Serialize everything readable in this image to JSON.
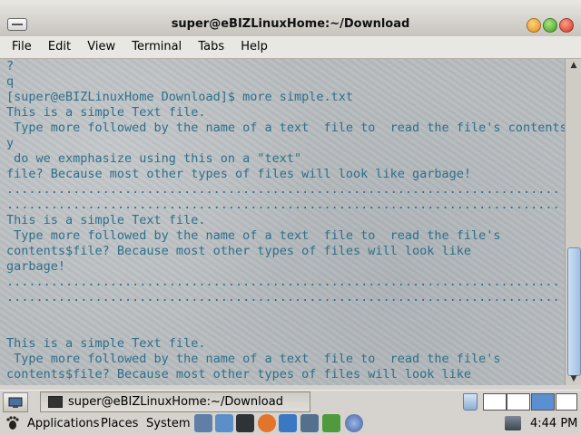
{
  "window": {
    "title": "super@eBIZLinuxHome:~/Download"
  },
  "menubar": {
    "items": [
      "File",
      "Edit",
      "View",
      "Terminal",
      "Tabs",
      "Help"
    ]
  },
  "terminal": {
    "lines": [
      "?",
      "q",
      "[super@eBIZLinuxHome Download]$ more simple.txt",
      "This is a simple Text file.",
      " Type more followed by the name of a text  file to  read the file's contents.",
      "y",
      " do we exmphasize using this on a \"text\"",
      "file? Because most other types of files will look like garbage!",
      "...........................................................................",
      "...........................................................................",
      "This is a simple Text file.",
      " Type more followed by the name of a text  file to  read the file's",
      "contents$file? Because most other types of files will look like",
      "garbage!",
      "...........................................................................",
      "...........................................................................",
      "",
      "",
      "This is a simple Text file.",
      " Type more followed by the name of a text  file to  read the file's",
      "contents$file? Because most other types of files will look like"
    ]
  },
  "taskbar": {
    "task_label": "super@eBIZLinuxHome:~/Download"
  },
  "panel": {
    "applications": "Applications",
    "places": "Places",
    "system": "System",
    "clock": "4:44 PM"
  },
  "colors": {
    "terminal_text": "#2d6f8a",
    "active_workspace": "#5a8fd1"
  }
}
